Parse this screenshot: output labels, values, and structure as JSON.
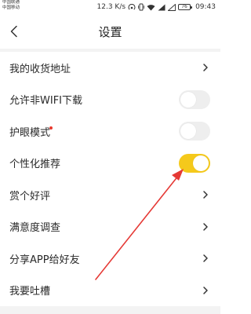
{
  "status_bar": {
    "carrier_1": "中国联通",
    "carrier_2": "中国移动",
    "speed": "12.3 K/s",
    "battery": "76",
    "time": "09:43",
    "icons": [
      "hotspot-icon",
      "vibrate-icon",
      "wifi-icon",
      "signal-icon",
      "battery-icon"
    ]
  },
  "nav": {
    "title": "设置",
    "back_icon": "chevron-left-icon"
  },
  "settings": {
    "items": [
      {
        "label": "我的收货地址",
        "control": "chevron"
      },
      {
        "label": "允许非WIFI下载",
        "control": "toggle",
        "on": false
      },
      {
        "label": "护眼模式",
        "control": "toggle",
        "on": false,
        "badge": "red-dot"
      },
      {
        "label": "个性化推荐",
        "control": "toggle",
        "on": true
      },
      {
        "label": "赏个好评",
        "control": "chevron"
      },
      {
        "label": "满意度调查",
        "control": "chevron"
      },
      {
        "label": "分享APP给好友",
        "control": "chevron"
      },
      {
        "label": "我要吐槽",
        "control": "chevron"
      }
    ]
  },
  "colors": {
    "toggle_on": "#f5c91b",
    "toggle_off": "#eeeeee",
    "annotation_arrow": "#e53935",
    "badge": "#e8392d"
  }
}
